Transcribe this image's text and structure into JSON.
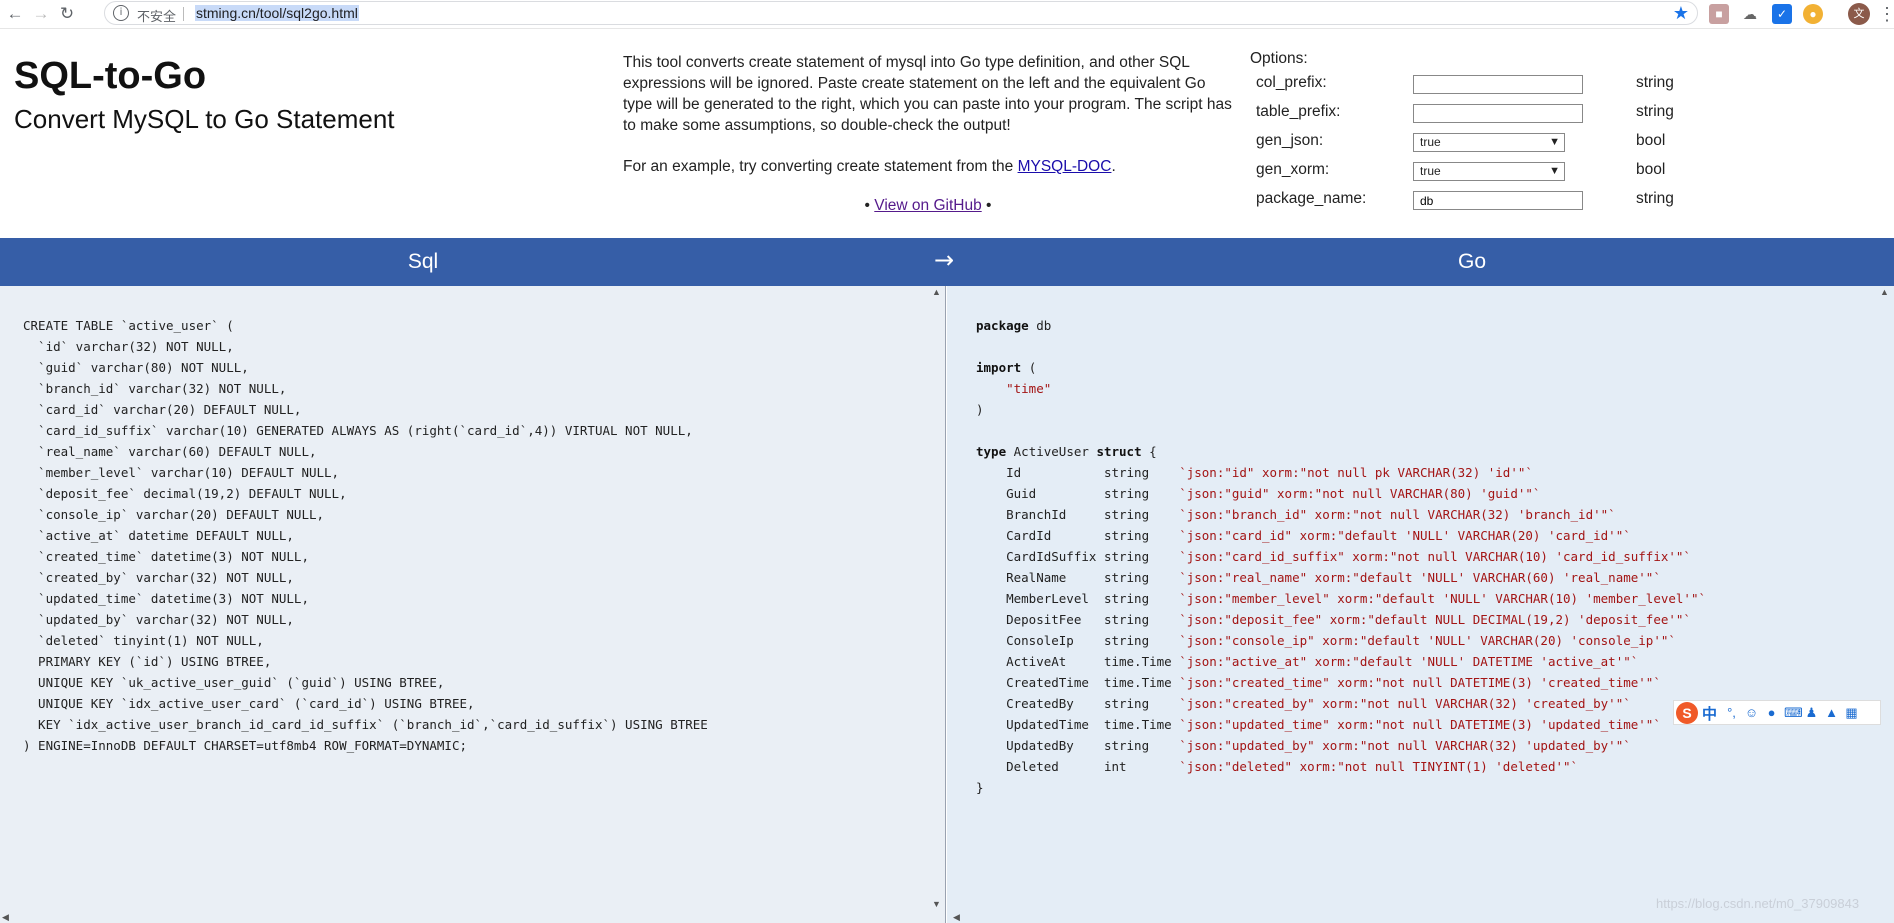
{
  "browser": {
    "back_icon": "arrow-left-icon",
    "forward_icon": "arrow-right-icon",
    "reload_icon": "reload-icon",
    "security_label": "不安全",
    "url": "stming.cn/tool/sql2go.html",
    "bookmark_icon": "star-icon",
    "avatar_label": "文"
  },
  "header": {
    "title": "SQL-to-Go",
    "subtitle": "Convert MySQL to Go Statement"
  },
  "description": {
    "paragraph1": "This tool converts create statement of mysql into Go type definition, and other SQL expressions will be ignored. Paste create statement on the left and the equivalent Go type will be generated to the right, which you can paste into your program. The script has to make some assumptions, so double-check the output!",
    "paragraph2_prefix": "For an example, try converting create statement from the ",
    "paragraph2_link": "MYSQL-DOC",
    "paragraph2_suffix": ".",
    "github_bullet": "•",
    "github_link": "View on GitHub"
  },
  "options": {
    "title": "Options:",
    "col_prefix": {
      "label": "col_prefix:",
      "value": "",
      "type": "string"
    },
    "table_prefix": {
      "label": "table_prefix:",
      "value": "",
      "type": "string"
    },
    "gen_json": {
      "label": "gen_json:",
      "value": "true",
      "type": "bool"
    },
    "gen_xorm": {
      "label": "gen_xorm:",
      "value": "true",
      "type": "bool"
    },
    "package_name": {
      "label": "package_name:",
      "value": "db",
      "type": "string"
    }
  },
  "bar": {
    "left_label": "Sql",
    "arrow": "→",
    "right_label": "Go",
    "color": "#365ea7"
  },
  "sql_input": "CREATE TABLE `active_user` (\n  `id` varchar(32) NOT NULL,\n  `guid` varchar(80) NOT NULL,\n  `branch_id` varchar(32) NOT NULL,\n  `card_id` varchar(20) DEFAULT NULL,\n  `card_id_suffix` varchar(10) GENERATED ALWAYS AS (right(`card_id`,4)) VIRTUAL NOT NULL,\n  `real_name` varchar(60) DEFAULT NULL,\n  `member_level` varchar(10) DEFAULT NULL,\n  `deposit_fee` decimal(19,2) DEFAULT NULL,\n  `console_ip` varchar(20) DEFAULT NULL,\n  `active_at` datetime DEFAULT NULL,\n  `created_time` datetime(3) NOT NULL,\n  `created_by` varchar(32) NOT NULL,\n  `updated_time` datetime(3) NOT NULL,\n  `updated_by` varchar(32) NOT NULL,\n  `deleted` tinyint(1) NOT NULL,\n  PRIMARY KEY (`id`) USING BTREE,\n  UNIQUE KEY `uk_active_user_guid` (`guid`) USING BTREE,\n  UNIQUE KEY `idx_active_user_card` (`card_id`) USING BTREE,\n  KEY `idx_active_user_branch_id_card_id_suffix` (`branch_id`,`card_id_suffix`) USING BTREE\n) ENGINE=InnoDB DEFAULT CHARSET=utf8mb4 ROW_FORMAT=DYNAMIC;",
  "go_output": {
    "package_kw": "package",
    "package_name": "db",
    "import_kw": "import",
    "import_open": "(",
    "import_path": "\"time\"",
    "import_close": ")",
    "type_kw": "type",
    "struct_name": "ActiveUser",
    "struct_kw": "struct",
    "open_brace": "{",
    "close_brace": "}",
    "fields": [
      {
        "name": "Id",
        "type": "string",
        "tag": "`json:\"id\" xorm:\"not null pk VARCHAR(32) 'id'\"`"
      },
      {
        "name": "Guid",
        "type": "string",
        "tag": "`json:\"guid\" xorm:\"not null VARCHAR(80) 'guid'\"`"
      },
      {
        "name": "BranchId",
        "type": "string",
        "tag": "`json:\"branch_id\" xorm:\"not null VARCHAR(32) 'branch_id'\"`"
      },
      {
        "name": "CardId",
        "type": "string",
        "tag": "`json:\"card_id\" xorm:\"default 'NULL' VARCHAR(20) 'card_id'\"`"
      },
      {
        "name": "CardIdSuffix",
        "type": "string",
        "tag": "`json:\"card_id_suffix\" xorm:\"not null VARCHAR(10) 'card_id_suffix'\"`"
      },
      {
        "name": "RealName",
        "type": "string",
        "tag": "`json:\"real_name\" xorm:\"default 'NULL' VARCHAR(60) 'real_name'\"`"
      },
      {
        "name": "MemberLevel",
        "type": "string",
        "tag": "`json:\"member_level\" xorm:\"default 'NULL' VARCHAR(10) 'member_level'\"`"
      },
      {
        "name": "DepositFee",
        "type": "string",
        "tag": "`json:\"deposit_fee\" xorm:\"default NULL DECIMAL(19,2) 'deposit_fee'\"`"
      },
      {
        "name": "ConsoleIp",
        "type": "string",
        "tag": "`json:\"console_ip\" xorm:\"default 'NULL' VARCHAR(20) 'console_ip'\"`"
      },
      {
        "name": "ActiveAt",
        "type": "time.Time",
        "tag": "`json:\"active_at\" xorm:\"default 'NULL' DATETIME 'active_at'\"`"
      },
      {
        "name": "CreatedTime",
        "type": "time.Time",
        "tag": "`json:\"created_time\" xorm:\"not null DATETIME(3) 'created_time'\"`"
      },
      {
        "name": "CreatedBy",
        "type": "string",
        "tag": "`json:\"created_by\" xorm:\"not null VARCHAR(32) 'created_by'\"`"
      },
      {
        "name": "UpdatedTime",
        "type": "time.Time",
        "tag": "`json:\"updated_time\" xorm:\"not null DATETIME(3) 'updated_time'\"`"
      },
      {
        "name": "UpdatedBy",
        "type": "string",
        "tag": "`json:\"updated_by\" xorm:\"not null VARCHAR(32) 'updated_by'\"`"
      },
      {
        "name": "Deleted",
        "type": "int",
        "tag": "`json:\"deleted\" xorm:\"not null TINYINT(1) 'deleted'\"`"
      }
    ]
  },
  "ime_toolbar": {
    "logo": "S",
    "mode": "中",
    "icons": [
      "punctuation-icon",
      "emoji-icon",
      "microphone-icon",
      "keyboard-icon",
      "user-icon",
      "skin-icon",
      "grid-icon"
    ]
  },
  "watermark": "https://blog.csdn.net/m0_37909843"
}
